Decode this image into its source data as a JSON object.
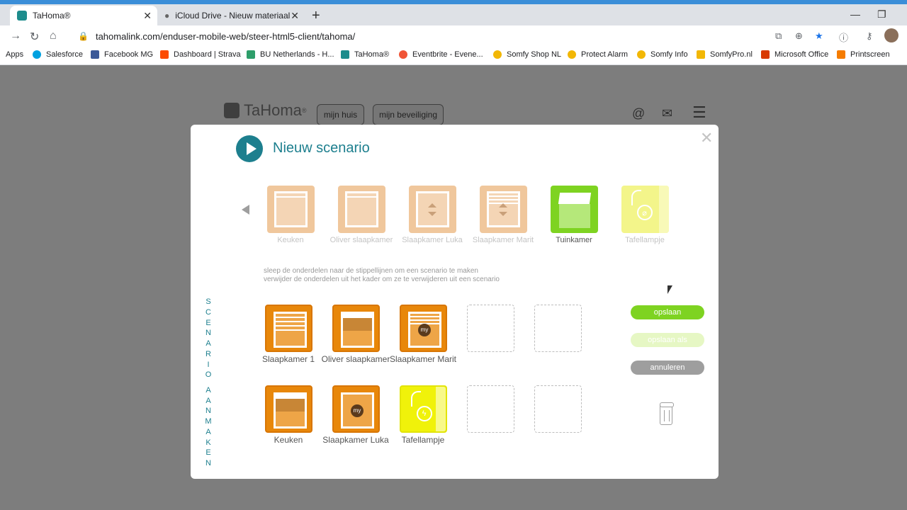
{
  "browser": {
    "tabs": [
      {
        "title": "TaHoma®",
        "active": true
      },
      {
        "title": "iCloud Drive - Nieuw materiaal",
        "active": false
      }
    ],
    "url": "tahomalink.com/enduser-mobile-web/steer-html5-client/tahoma/",
    "bookmarks": [
      {
        "label": "Apps",
        "icon": "apps-grid-icon",
        "color": "#4285f4"
      },
      {
        "label": "Salesforce",
        "icon": "salesforce-cloud-icon",
        "color": "#00a1e0"
      },
      {
        "label": "Facebook MG",
        "icon": "facebook-icon",
        "color": "#3b5998"
      },
      {
        "label": "Dashboard | Strava",
        "icon": "strava-icon",
        "color": "#fc4c02"
      },
      {
        "label": "BU Netherlands - H...",
        "icon": "puzzle-icon",
        "color": "#2e9e6a"
      },
      {
        "label": "TaHoma®",
        "icon": "tahoma-house-icon",
        "color": "#1d8c8c"
      },
      {
        "label": "Eventbrite - Evene...",
        "icon": "eventbrite-icon",
        "color": "#f05537"
      },
      {
        "label": "Somfy Shop NL",
        "icon": "somfy-icon",
        "color": "#f2b705"
      },
      {
        "label": "Protect Alarm",
        "icon": "somfy-icon",
        "color": "#f2b705"
      },
      {
        "label": "Somfy Info",
        "icon": "somfy-icon",
        "color": "#f2b705"
      },
      {
        "label": "SomfyPro.nl",
        "icon": "somfypro-icon",
        "color": "#f2b705"
      },
      {
        "label": "Microsoft Office",
        "icon": "office-icon",
        "color": "#d83b01"
      },
      {
        "label": "Printscreen",
        "icon": "printscreen-icon",
        "color": "#f57c00"
      }
    ]
  },
  "background_page": {
    "logo": "TaHoma",
    "tabs": [
      "mijn huis",
      "mijn beveiliging"
    ]
  },
  "modal": {
    "title": "Nieuw scenario",
    "rooms": [
      {
        "label": "Keuken",
        "kind": "window",
        "tile_color": "#f0c79c",
        "label_color": "#c4c4c4"
      },
      {
        "label": "Oliver slaapkamer",
        "kind": "window",
        "tile_color": "#f0c79c",
        "label_color": "#c4c4c4"
      },
      {
        "label": "Slaapkamer Luka",
        "kind": "updown",
        "tile_color": "#f0c79c",
        "label_color": "#c4c4c4"
      },
      {
        "label": "Slaapkamer Marit",
        "kind": "slats-updown",
        "tile_color": "#f0c79c",
        "label_color": "#c4c4c4"
      },
      {
        "label": "Tuinkamer",
        "kind": "garden",
        "tile_color": "#7ed321",
        "label_color": "#555555"
      },
      {
        "label": "Tafellampje",
        "kind": "plug",
        "tile_color": "#f3f58a",
        "label_color": "#c4c4c4"
      }
    ],
    "instructions": [
      "sleep de onderdelen naar de stippellijnen om een scenario te maken",
      "verwijder de onderdelen uit het kader om ze te verwijderen uit een scenario"
    ],
    "vertical_label": "SCENARIO AANMAKEN",
    "scenario_slots": [
      {
        "label": "Slaapkamer 1",
        "kind": "slats"
      },
      {
        "label": "Oliver slaapkamer",
        "kind": "half"
      },
      {
        "label": "Slaapkamer Marit",
        "kind": "slats-my"
      },
      {
        "label": "Keuken",
        "kind": "half"
      },
      {
        "label": "Slaapkamer Luka",
        "kind": "my"
      },
      {
        "label": "Tafellampje",
        "kind": "plug"
      }
    ],
    "buttons": {
      "save": "opslaan",
      "save_as": "opslaan als",
      "cancel": "annuleren"
    },
    "colors": {
      "accent": "#1d7f8e",
      "save": "#7ed321",
      "save_as": "#e6f7c4",
      "cancel": "#9e9e9e",
      "device_orange": "#e8870a",
      "plug_yellow": "#f0f20a"
    }
  }
}
